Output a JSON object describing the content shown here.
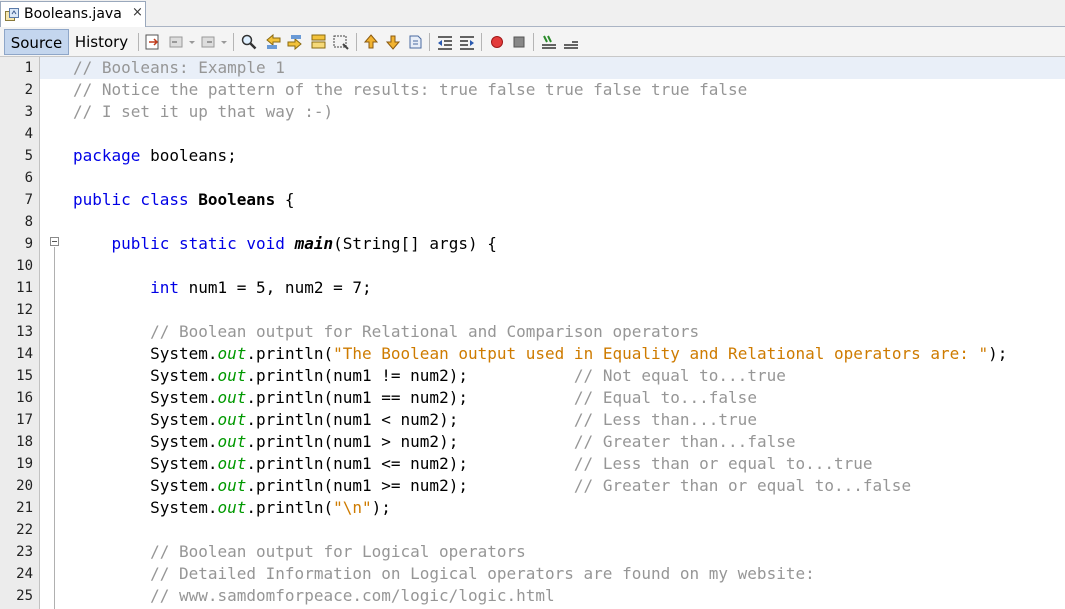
{
  "tab": {
    "title": "Booleans.java",
    "close": "×"
  },
  "toolbar": {
    "source_label": "Source",
    "history_label": "History",
    "icons": [
      "last-edit-icon",
      "back-icon",
      "forward-icon",
      "find-icon",
      "find-previous-icon",
      "find-next-icon",
      "toggle-highlight-icon",
      "find-selection-icon",
      "previous-bookmark-icon",
      "next-bookmark-icon",
      "toggle-bookmark-icon",
      "shift-left-icon",
      "shift-right-icon",
      "record-macro-icon",
      "stop-macro-icon",
      "comment-icon",
      "uncomment-icon"
    ]
  },
  "editor": {
    "line_numbers": [
      "1",
      "2",
      "3",
      "4",
      "5",
      "6",
      "7",
      "8",
      "9",
      "10",
      "11",
      "12",
      "13",
      "14",
      "15",
      "16",
      "17",
      "18",
      "19",
      "20",
      "21",
      "22",
      "23",
      "24",
      "25"
    ],
    "lines": {
      "l1": "// Booleans: Example 1",
      "l2": "// Notice the pattern of the results: true false true false true false",
      "l3": "// I set it up that way :-)",
      "l5_kw": "package",
      "l5_rest": " booleans;",
      "l7_kw": "public class",
      "l7_name": "Booleans",
      "l7_rest": " {",
      "l9_kw": "public static void",
      "l9_name": "main",
      "l9_rest": "(String[] args) {",
      "l11_kw": "int",
      "l11_rest": " num1 = 5, num2 = 7;",
      "l13": "// Boolean output for Relational and Comparison operators",
      "sys": "System.",
      "out": "out",
      "l14_pre": ".println(",
      "l14_str": "\"The Boolean output used in Equality and Relational operators are: \"",
      "l14_post": ");",
      "l15_code": ".println(num1 != num2);           ",
      "l15_comment": "// Not equal to...true",
      "l16_code": ".println(num1 == num2);           ",
      "l16_comment": "// Equal to...false",
      "l17_code": ".println(num1 < num2);            ",
      "l17_comment": "// Less than...true",
      "l18_code": ".println(num1 > num2);            ",
      "l18_comment": "// Greater than...false",
      "l19_code": ".println(num1 <= num2);           ",
      "l19_comment": "// Less than or equal to...true",
      "l20_code": ".println(num1 >= num2);           ",
      "l20_comment": "// Greater than or equal to...false",
      "l21_pre": ".println(",
      "l21_str": "\"\\n\"",
      "l21_post": ");",
      "l23": "// Boolean output for Logical operators",
      "l24": "// Detailed Information on Logical operators are found on my website:",
      "l25": "// www.samdomforpeace.com/logic/logic.html"
    }
  },
  "colors": {
    "comment": "#969696",
    "keyword": "#0000e6",
    "string": "#ce7b00",
    "field": "#009900",
    "current_line": "#e9eff8"
  }
}
